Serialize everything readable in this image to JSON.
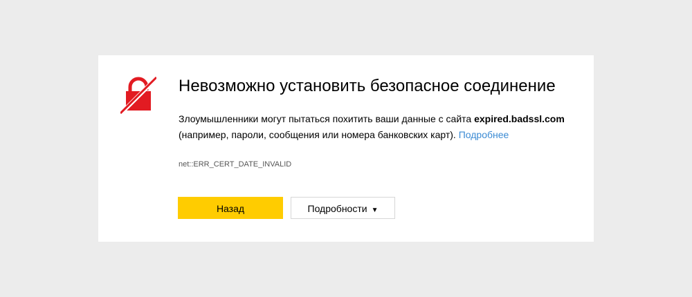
{
  "error_page": {
    "title": "Невозможно установить безопасное соединение",
    "description_before": "Злоумышленники могут пытаться похитить ваши данные с сайта ",
    "domain": "expired.badssl.com",
    "description_after": " (например, пароли, сообщения или номера банковских карт). ",
    "more_link": "Подробнее",
    "error_code": "net::ERR_CERT_DATE_INVALID",
    "back_button": "Назад",
    "details_button": "Подробности",
    "details_caret": "▼",
    "icon": "broken-lock-icon"
  },
  "colors": {
    "background": "#ececec",
    "card": "#ffffff",
    "icon_red": "#e21b22",
    "primary_button": "#ffcc00",
    "link": "#3a8ad3"
  }
}
